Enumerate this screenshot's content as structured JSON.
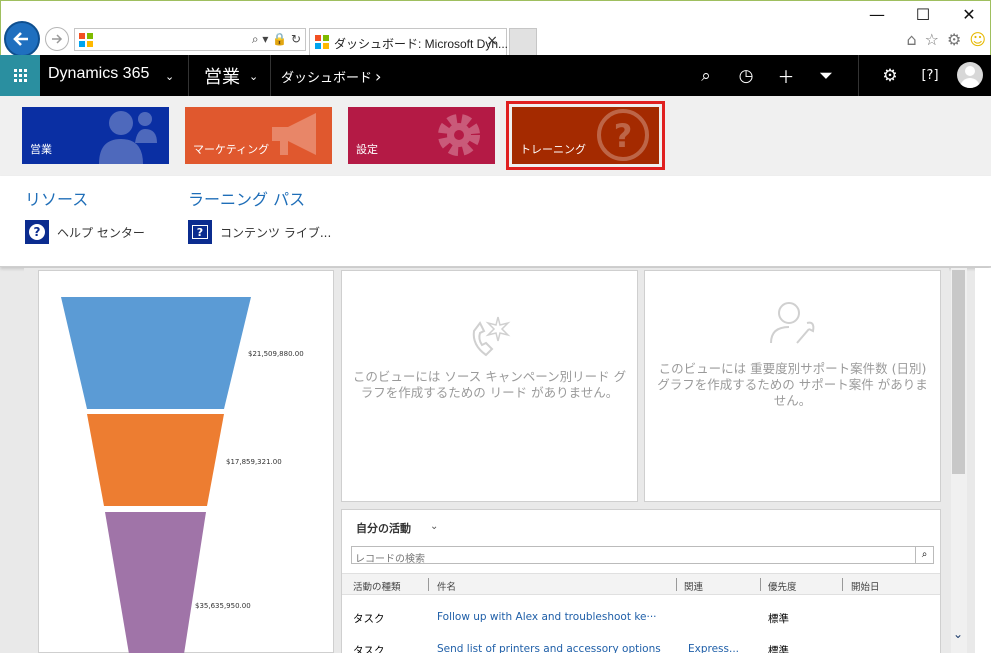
{
  "browser": {
    "address_value": "",
    "tab_title": "ダッシュボード: Microsoft Dyn...",
    "tab_close": "×",
    "win_min": "—",
    "win_max": "☐",
    "win_close": "✕",
    "address_icons": "⌕ ▾ 🔒 ↻"
  },
  "navbar": {
    "app_name": "Dynamics 365",
    "area": "営業",
    "page": "ダッシュボード",
    "chevron": "⌄",
    "arrow": "›"
  },
  "sitemap": {
    "tiles": [
      {
        "label": "営業",
        "color": "#0a2fa3"
      },
      {
        "label": "マーケティング",
        "color": "#e0582e"
      },
      {
        "label": "設定",
        "color": "#b41a45"
      },
      {
        "label": "トレーニング",
        "color": "#a42a00"
      }
    ],
    "groups": [
      {
        "title": "リソース",
        "link": "ヘルプ センター",
        "icon": "?"
      },
      {
        "title": "ラーニング パス",
        "link": "コンテンツ ライブ...",
        "icon": "?"
      }
    ]
  },
  "dashboard": {
    "funnel_labels": [
      "$21,509,880.00",
      "$17,859,321.00",
      "$35,635,950.00"
    ],
    "funnel_colors": [
      "#5b9bd5",
      "#ed7d31",
      "#a074a8"
    ],
    "empty1": "このビューには ソース キャンペーン別リード グラフを作成するための リード がありません。",
    "empty2": "このビューには 重要度別サポート案件数 (日別) グラフを作成するための サポート案件 がありません。",
    "activities": {
      "title": "自分の活動",
      "search_placeholder": "レコードの検索",
      "columns": [
        "活動の種類",
        "件名",
        "関連",
        "優先度",
        "開始日"
      ],
      "rows": [
        {
          "type": "タスク",
          "subject": "Follow up with Alex and troubleshoot ke···",
          "regarding": "",
          "priority": "標準"
        },
        {
          "type": "タスク",
          "subject": "Send list of printers and accessory options",
          "regarding": "Express...",
          "priority": "標準"
        }
      ]
    }
  }
}
